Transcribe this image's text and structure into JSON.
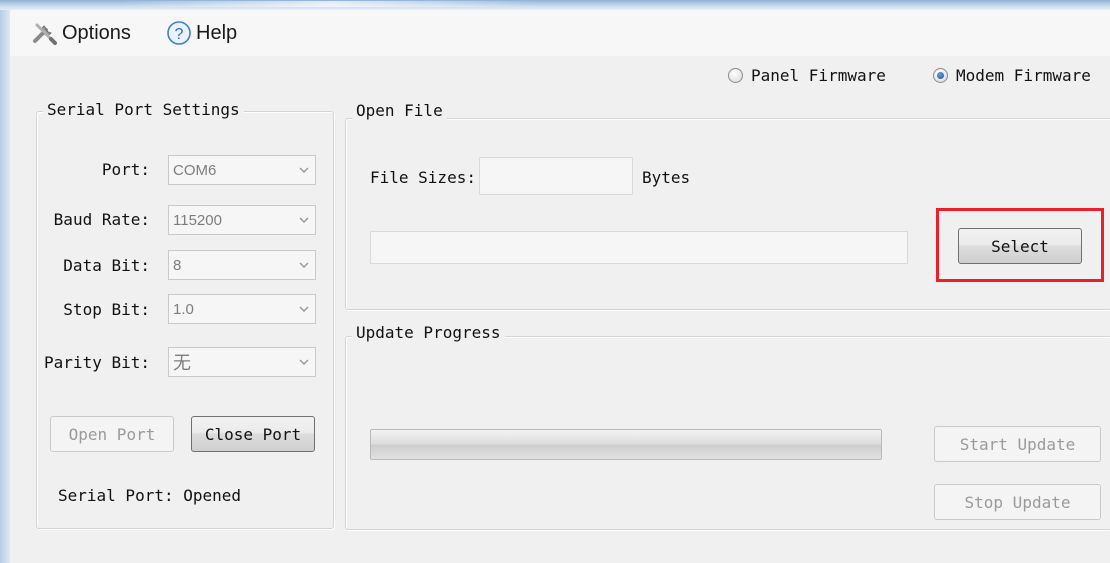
{
  "menu": {
    "options_label": "Options",
    "help_label": "Help",
    "options_icon": "tools-icon",
    "help_icon": "help-icon"
  },
  "firmware_mode": {
    "panel_label": "Panel Firmware",
    "modem_label": "Modem Firmware",
    "selected": "modem"
  },
  "serial": {
    "title": "Serial Port Settings",
    "port_label": "Port:",
    "port_value": "COM6",
    "baud_label": "Baud Rate:",
    "baud_value": "115200",
    "data_label": "Data Bit:",
    "data_value": "8",
    "stop_label": "Stop Bit:",
    "stop_value": "1.0",
    "parity_label": "Parity Bit:",
    "parity_value": "无",
    "open_button": "Open Port",
    "close_button": "Close Port",
    "status_text": "Serial Port: Opened"
  },
  "open_file": {
    "title": "Open File",
    "size_label": "File Sizes:",
    "size_value": "",
    "unit_label": "Bytes",
    "path_value": "",
    "select_button": "Select",
    "highlight_color": "#e8202a"
  },
  "update": {
    "title": "Update Progress",
    "progress": 0,
    "start_button": "Start Update",
    "stop_button": "Stop Update"
  }
}
